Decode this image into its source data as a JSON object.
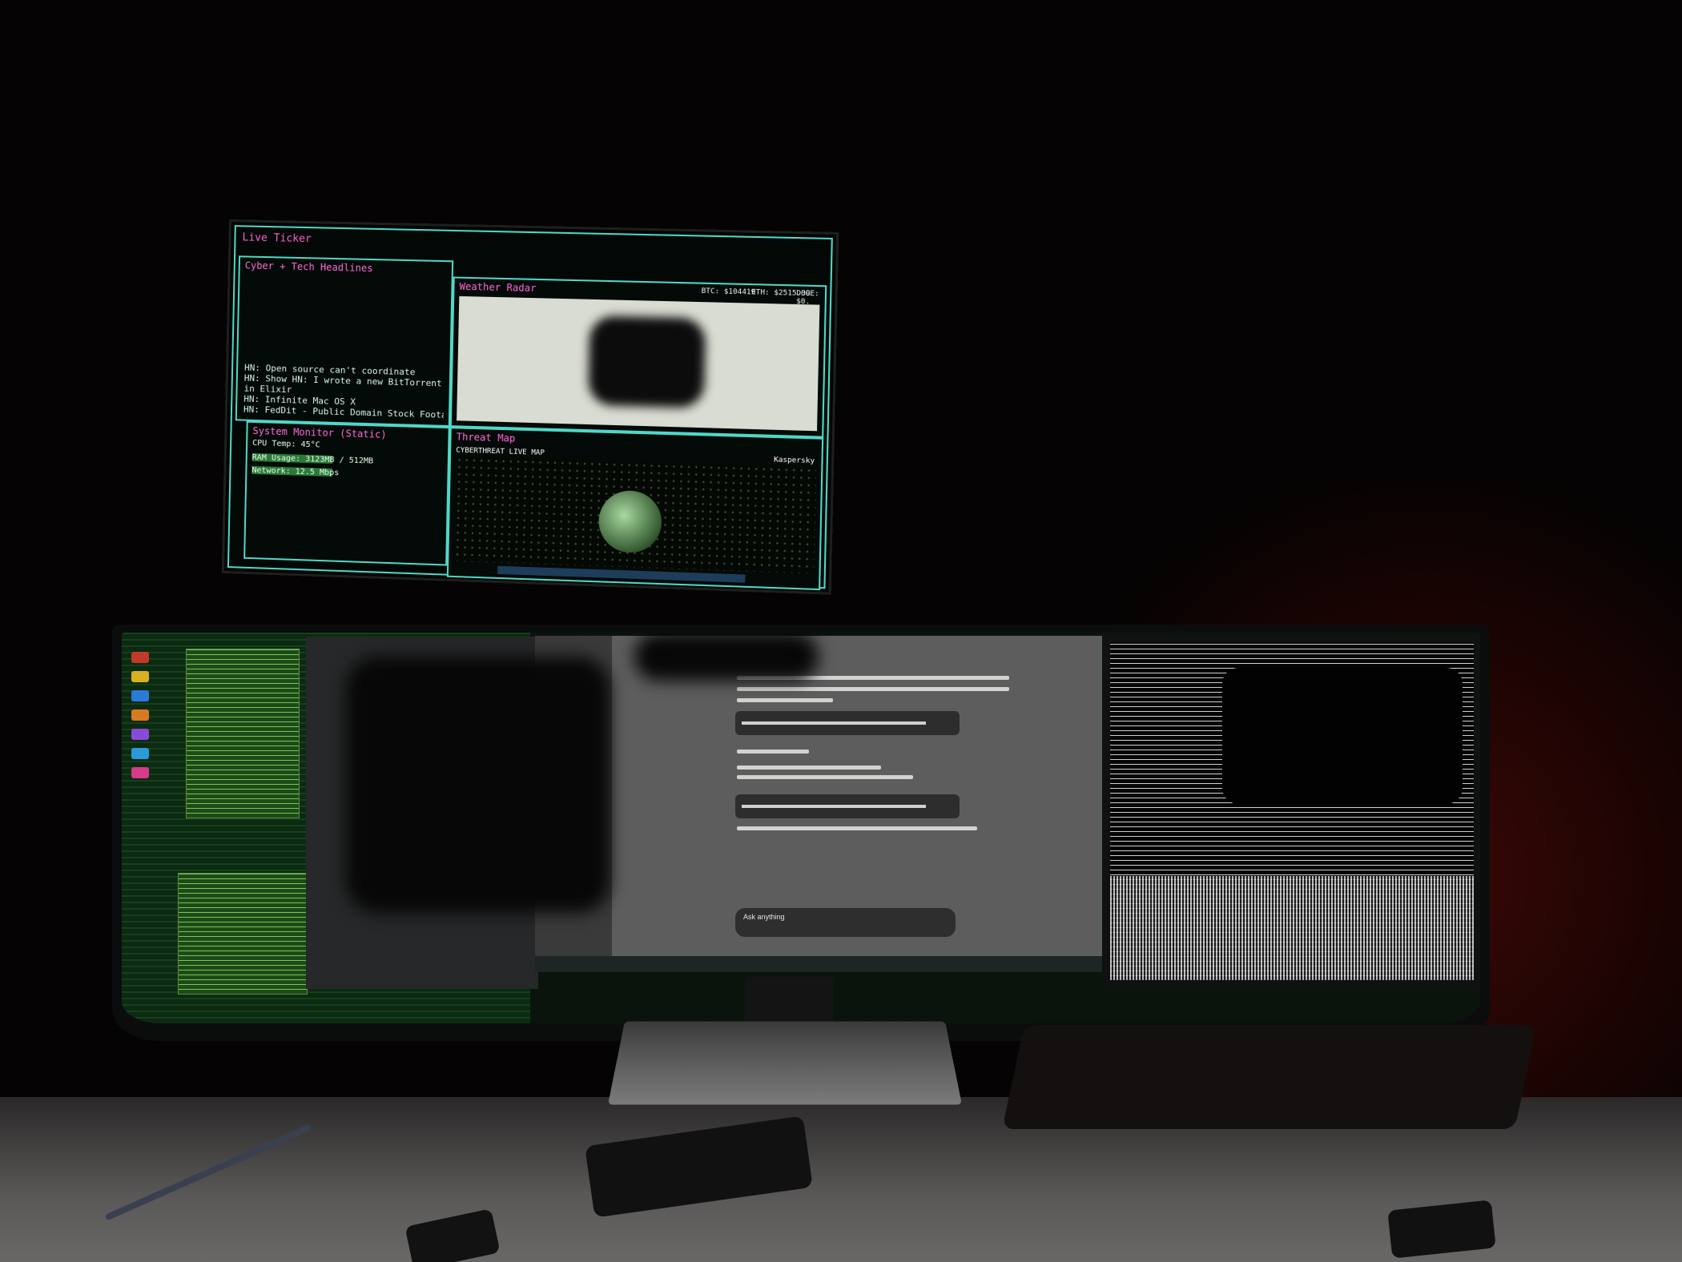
{
  "top_monitor": {
    "title": "Live Ticker",
    "headlines_panel": {
      "title": "Cyber + Tech Headlines",
      "items": [
        "HN: Open source can't coordinate",
        "HN: Show HN: I wrote a new BitTorrent tracker",
        "in Elixir",
        "HN: Infinite Mac OS X",
        "HN: FedDit - Public Domain Stock Footage"
      ]
    },
    "weather_panel": {
      "title": "Weather Radar",
      "ticker": [
        "BTC: $104419",
        "ETH: $2515.39",
        "DOGE: $0."
      ]
    },
    "system_panel": {
      "title": "System Monitor (Static)",
      "rows": [
        "CPU Temp: 45°C",
        "RAM Usage: 3123MB / 512MB",
        "Network: 12.5 Mbps"
      ]
    },
    "threat_panel": {
      "title": "Threat Map",
      "header": "CYBERTHREAT LIVE MAP",
      "brand": "Kaspersky"
    }
  },
  "center_monitor": {
    "chat_input_placeholder": "Ask anything"
  },
  "colors": {
    "accent_cyan": "#4fd8c8",
    "accent_pink": "#ff5fd2",
    "red_led": "#e21a0f"
  }
}
